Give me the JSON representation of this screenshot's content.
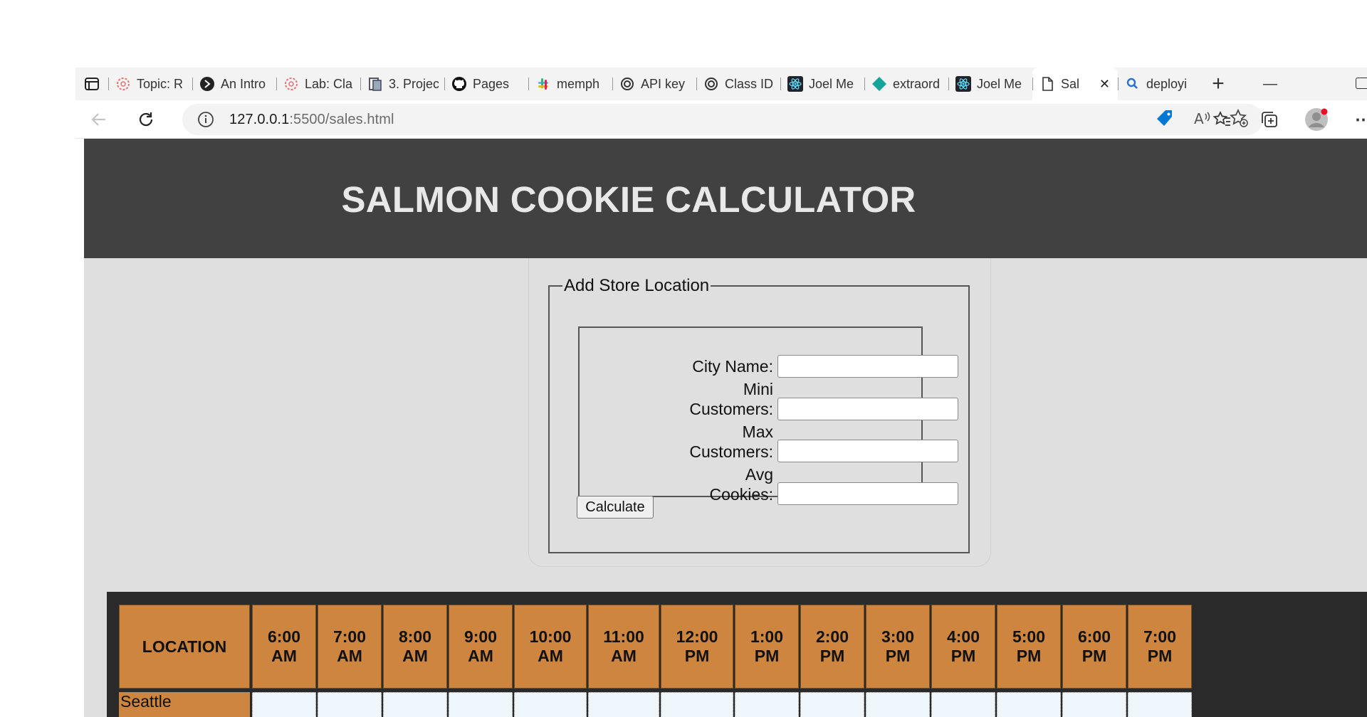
{
  "browser": {
    "tabs": [
      {
        "label": "Topic: R",
        "icon": "canvas-icon"
      },
      {
        "label": "An Intro",
        "icon": "shield-logo-icon"
      },
      {
        "label": "Lab: Cla",
        "icon": "canvas-icon"
      },
      {
        "label": "3. Projec",
        "icon": "book-icon"
      },
      {
        "label": "Pages",
        "icon": "github-icon"
      },
      {
        "label": "memph",
        "icon": "slack-icon"
      },
      {
        "label": "API key",
        "icon": "openai-icon"
      },
      {
        "label": "Class ID",
        "icon": "openai-icon"
      },
      {
        "label": "Joel Me",
        "icon": "react-icon"
      },
      {
        "label": "extraord",
        "icon": "diamond-icon"
      },
      {
        "label": "Joel Me",
        "icon": "react-icon"
      },
      {
        "label": "Sal",
        "icon": "page-icon",
        "active": true
      },
      {
        "label": "deployi",
        "icon": "search-icon"
      }
    ],
    "url_host": "127.0.0.1",
    "url_rest": ":5500/sales.html",
    "colors": {
      "accent": "#0078d4"
    }
  },
  "page": {
    "title": "SALMON COOKIE CALCULATOR",
    "form": {
      "legend": "Add Store Location",
      "fields": [
        {
          "label": "City Name:",
          "value": ""
        },
        {
          "label": "Mini Customers:",
          "value": ""
        },
        {
          "label": "Max Customers:",
          "value": ""
        },
        {
          "label": "Avg Cookies:",
          "value": ""
        }
      ],
      "submit_label": "Calculate"
    },
    "table": {
      "headers": [
        "LOCATION",
        "6:00 AM",
        "7:00 AM",
        "8:00 AM",
        "9:00 AM",
        "10:00 AM",
        "11:00 AM",
        "12:00 PM",
        "1:00 PM",
        "2:00 PM",
        "3:00 PM",
        "4:00 PM",
        "5:00 PM",
        "6:00 PM",
        "7:00 PM"
      ],
      "rows": [
        {
          "location": "Seattle"
        }
      ]
    },
    "colors": {
      "header_bg": "#414141",
      "table_header": "#cd853f",
      "page_bg": "#e0dfe0"
    }
  }
}
